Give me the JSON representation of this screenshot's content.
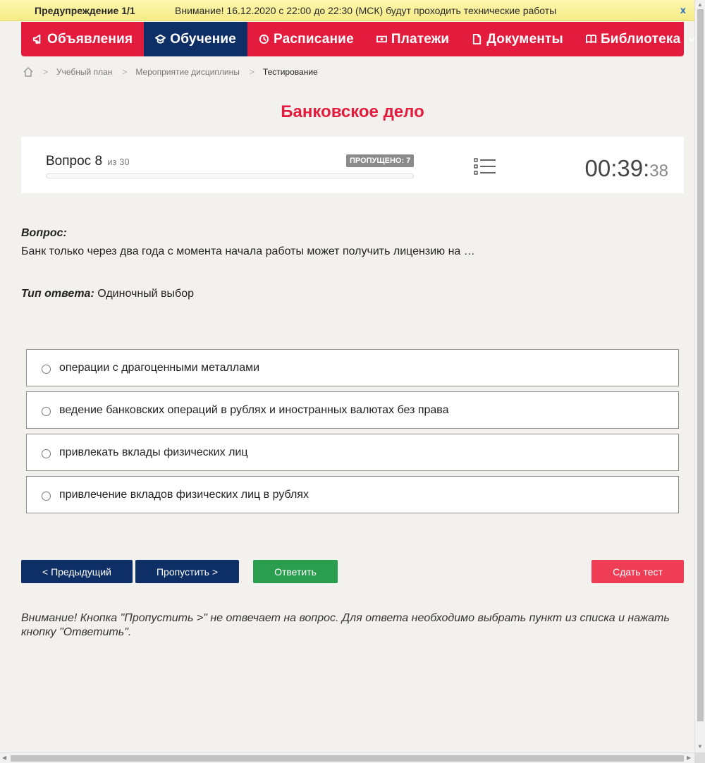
{
  "warning": {
    "counter": "Предупреждение 1/1",
    "message": "Внимание! 16.12.2020 с 22:00 до 22:30 (МСК) будут проходить технические работы",
    "close": "x"
  },
  "nav": {
    "items": [
      {
        "label": "Объявления",
        "icon": "megaphone-icon"
      },
      {
        "label": "Обучение",
        "icon": "graduation-cap-icon",
        "active": true
      },
      {
        "label": "Расписание",
        "icon": "clock-icon"
      },
      {
        "label": "Платежи",
        "icon": "money-icon"
      },
      {
        "label": "Документы",
        "icon": "document-icon"
      },
      {
        "label": "Библиотека",
        "icon": "book-icon"
      }
    ]
  },
  "breadcrumb": {
    "items": [
      "Учебный план",
      "Мероприятие дисциплины"
    ],
    "current": "Тестирование"
  },
  "page_title": "Банковское дело",
  "question_panel": {
    "label": "Вопрос 8",
    "of": "из 30",
    "skipped": "ПРОПУЩЕНО: 7",
    "timer_main": "00:39:",
    "timer_sec": "38",
    "progress": 0
  },
  "question": {
    "label": "Вопрос:",
    "text": "Банк только через два года с момента начала работы может получить лицензию на …",
    "answer_type_label": "Тип ответа:",
    "answer_type": "Одиночный выбор"
  },
  "options": [
    "операции с драгоценными металлами",
    "ведение банковских операций в рублях и иностранных валютах без права",
    "привлекать вклады физических лиц",
    "привлечение вкладов физических лиц в рублях"
  ],
  "buttons": {
    "prev": "< Предыдущий",
    "skip": "Пропустить >",
    "answer": "Ответить",
    "submit": "Сдать тест"
  },
  "notice": "Внимание! Кнопка \"Пропустить >\" не отвечает на вопрос. Для ответа необходимо выбрать пункт из списка и нажать кнопку \"Ответить\".",
  "colors": {
    "brand_red": "#e31c3d",
    "navy": "#0e2f66",
    "green": "#2a9d4f",
    "submit_red": "#ef3d55"
  }
}
